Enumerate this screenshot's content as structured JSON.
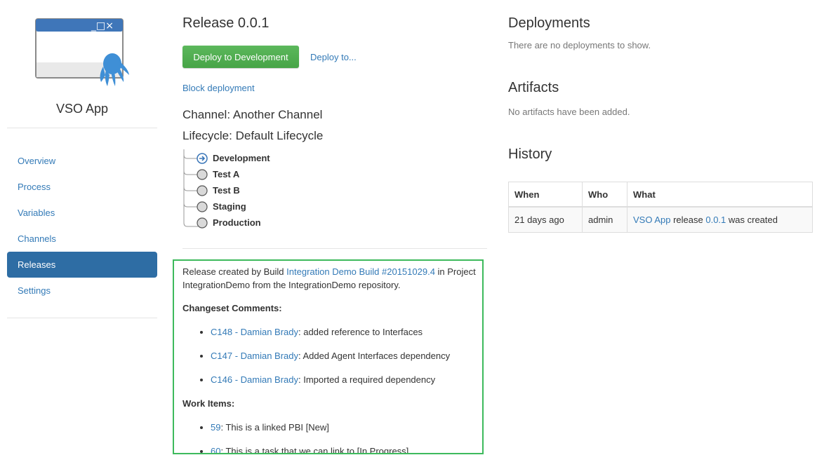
{
  "app": {
    "name": "VSO App",
    "logo_icon": "octopus-window-icon",
    "window_controls": "_□×"
  },
  "sidebar": {
    "items": [
      {
        "label": "Overview",
        "active": false
      },
      {
        "label": "Process",
        "active": false
      },
      {
        "label": "Variables",
        "active": false
      },
      {
        "label": "Channels",
        "active": false
      },
      {
        "label": "Releases",
        "active": true
      },
      {
        "label": "Settings",
        "active": false
      }
    ]
  },
  "release": {
    "title": "Release 0.0.1",
    "deploy_button": "Deploy to Development",
    "deploy_to_link": "Deploy to...",
    "block_link": "Block deployment",
    "channel": "Channel: Another Channel",
    "lifecycle": "Lifecycle: Default Lifecycle",
    "phases": [
      {
        "name": "Development",
        "icon": "arrow-circle-icon",
        "current": true
      },
      {
        "name": "Test A",
        "icon": "circle-icon",
        "current": false
      },
      {
        "name": "Test B",
        "icon": "circle-icon",
        "current": false
      },
      {
        "name": "Staging",
        "icon": "circle-icon",
        "current": false
      },
      {
        "name": "Production",
        "icon": "circle-icon",
        "current": false
      }
    ]
  },
  "notes": {
    "intro_prefix": "Release created by Build ",
    "build_link": "Integration Demo Build #20151029.4",
    "intro_suffix": " in Project IntegrationDemo from the IntegrationDemo repository.",
    "changesets_heading": "Changeset Comments:",
    "changesets": [
      {
        "link": "C148 - Damian Brady",
        "text": ": added reference to Interfaces"
      },
      {
        "link": "C147 - Damian Brady",
        "text": ": Added Agent Interfaces dependency"
      },
      {
        "link": "C146 - Damian Brady",
        "text": ": Imported a required dependency"
      }
    ],
    "work_items_heading": "Work Items:",
    "work_items": [
      {
        "link": "59",
        "text": ": This is a linked PBI [New]"
      },
      {
        "link": "60",
        "text": ": This is a task that we can link to [In Progress]"
      }
    ],
    "border_color": "#3dba5c"
  },
  "deployments": {
    "heading": "Deployments",
    "empty": "There are no deployments to show."
  },
  "artifacts": {
    "heading": "Artifacts",
    "empty": "No artifacts have been added."
  },
  "history": {
    "heading": "History",
    "columns": [
      "When",
      "Who",
      "What"
    ],
    "rows": [
      {
        "when": "21 days ago",
        "who": "admin",
        "what_project": "VSO App",
        "what_mid": " release ",
        "what_version": "0.0.1",
        "what_suffix": " was created"
      }
    ]
  },
  "colors": {
    "accent": "#337ab7",
    "active_nav": "#2e6da4",
    "deploy_button": "#5cb85c"
  }
}
